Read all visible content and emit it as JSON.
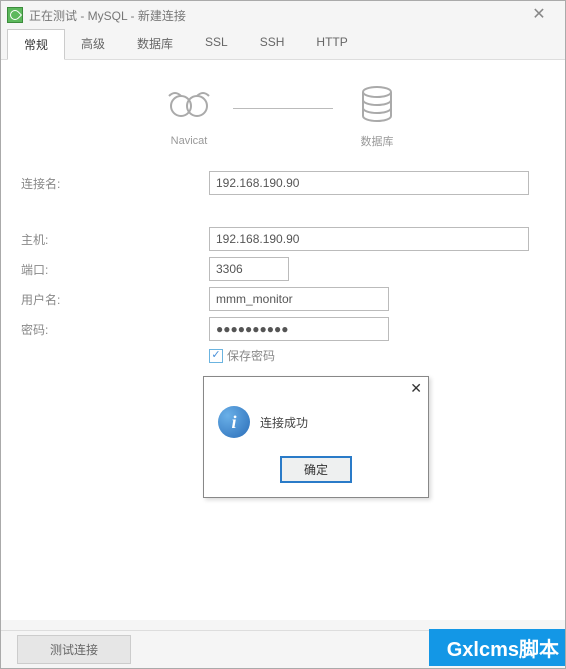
{
  "window": {
    "title": "正在测试 - MySQL - 新建连接"
  },
  "tabs": {
    "general": "常规",
    "advanced": "高级",
    "database": "数据库",
    "ssl": "SSL",
    "ssh": "SSH",
    "http": "HTTP"
  },
  "diagram": {
    "left_label": "Navicat",
    "right_label": "数据库"
  },
  "labels": {
    "conn_name": "连接名:",
    "host": "主机:",
    "port": "端口:",
    "user": "用户名:",
    "password": "密码:",
    "save_password": "保存密码"
  },
  "values": {
    "conn_name": "192.168.190.90",
    "host": "192.168.190.90",
    "port": "3306",
    "user": "mmm_monitor",
    "password": "●●●●●●●●●●"
  },
  "dialog": {
    "message": "连接成功",
    "ok": "确定"
  },
  "footer": {
    "test_connection": "测试连接"
  },
  "watermark": "Gxlcms脚本"
}
